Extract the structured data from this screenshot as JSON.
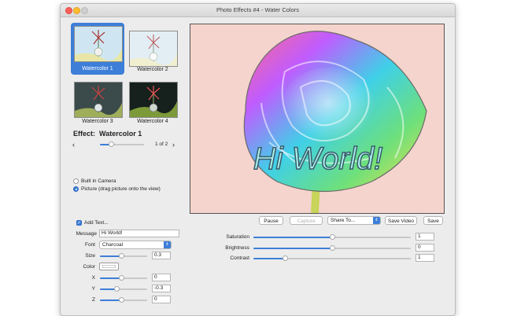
{
  "window": {
    "title": "Photo Effects #4 - Water Colors"
  },
  "effects": [
    {
      "label": "Watercolor 1",
      "selected": true
    },
    {
      "label": "Watercolor 2",
      "selected": false
    },
    {
      "label": "Watercolor 3",
      "selected": false
    },
    {
      "label": "Watercolor 4",
      "selected": false
    }
  ],
  "effect_header": {
    "prefix": "Effect:",
    "name": "Watercolor 1"
  },
  "pager": {
    "prev": "‹",
    "next": "›",
    "label": "1 of 2",
    "value": 0.25
  },
  "source": {
    "options": [
      {
        "label": "Built in Camera",
        "selected": false
      },
      {
        "label": "Picture (drag picture onto the view)",
        "selected": true
      }
    ]
  },
  "text_panel": {
    "add_text": {
      "label": "Add Text...",
      "checked": true
    },
    "message": {
      "label": "Message",
      "value": "Hi World!"
    },
    "font": {
      "label": "Font",
      "value": "Charcoal"
    },
    "size": {
      "label": "Size",
      "value": "0.3",
      "slider": 0.45
    },
    "color": {
      "label": "Color",
      "swatch": "#ffffff"
    },
    "x": {
      "label": "X",
      "value": "0",
      "slider": 0.45
    },
    "y": {
      "label": "Y",
      "value": "-0.3",
      "slider": 0.35
    },
    "z": {
      "label": "Z",
      "value": "0",
      "slider": 0.45
    }
  },
  "toolbar": {
    "pause": "Pause",
    "capture": "Capture",
    "share": "Share To...",
    "save_video": "Save Video",
    "save": "Save"
  },
  "adjustments": {
    "saturation": {
      "label": "Saturation",
      "value": "1",
      "slider": 0.5
    },
    "brightness": {
      "label": "Brightness",
      "value": "0",
      "slider": 0.5
    },
    "contrast": {
      "label": "Contrast",
      "value": "1",
      "slider": 0.2
    }
  },
  "preview": {
    "overlay_text": "Hi World!"
  },
  "colors": {
    "accent": "#3d7ed8",
    "preview_bg": "#f4d4cc"
  }
}
